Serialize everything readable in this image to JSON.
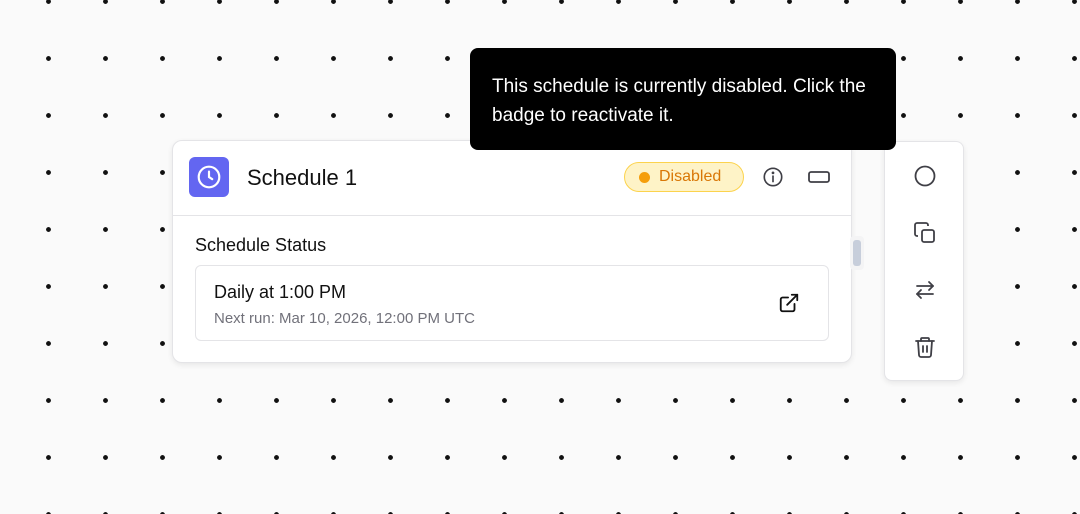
{
  "node": {
    "title": "Schedule 1",
    "icon": "clock-icon",
    "badge": {
      "label": "Disabled"
    },
    "section_label": "Schedule Status",
    "schedule": {
      "summary": "Daily at 1:00 PM",
      "next_run": "Next run: Mar 10, 2026, 12:00 PM UTC"
    }
  },
  "tooltip": {
    "text": "This schedule is currently disabled. Click the badge to reactivate it."
  },
  "toolbar": {
    "items": [
      "circle-icon",
      "copy-icon",
      "swap-icon",
      "trash-icon"
    ]
  },
  "colors": {
    "accent": "#6366f1",
    "badge_bg": "#fef3c7",
    "badge_text": "#d97706",
    "badge_dot": "#f59e0b",
    "tooltip_bg": "#000000"
  }
}
